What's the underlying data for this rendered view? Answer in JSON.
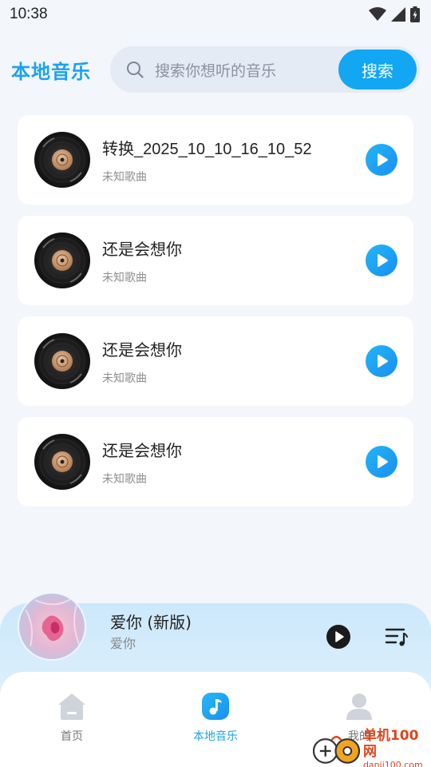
{
  "status_bar": {
    "time": "10:38"
  },
  "header": {
    "title": "本地音乐",
    "search_placeholder": "搜索你想听的音乐",
    "search_button": "搜索"
  },
  "songs": [
    {
      "title": "转换_2025_10_10_16_10_52",
      "artist": "未知歌曲"
    },
    {
      "title": "还是会想你",
      "artist": "未知歌曲"
    },
    {
      "title": "还是会想你",
      "artist": "未知歌曲"
    },
    {
      "title": "还是会想你",
      "artist": "未知歌曲"
    }
  ],
  "now_playing": {
    "title": "爱你 (新版)",
    "artist": "爱你"
  },
  "tabs": [
    {
      "label": "首页",
      "icon": "home-icon",
      "active": false
    },
    {
      "label": "本地音乐",
      "icon": "music-note-icon",
      "active": true
    },
    {
      "label": "我的",
      "icon": "user-icon",
      "active": false
    }
  ],
  "watermark": {
    "cn": "单机100网",
    "en": "danji100.com"
  },
  "colors": {
    "accent": "#19a3ee",
    "search_button": "#13a6f2",
    "play_gradient_start": "#22b6f7",
    "play_gradient_end": "#1a8ef0"
  }
}
